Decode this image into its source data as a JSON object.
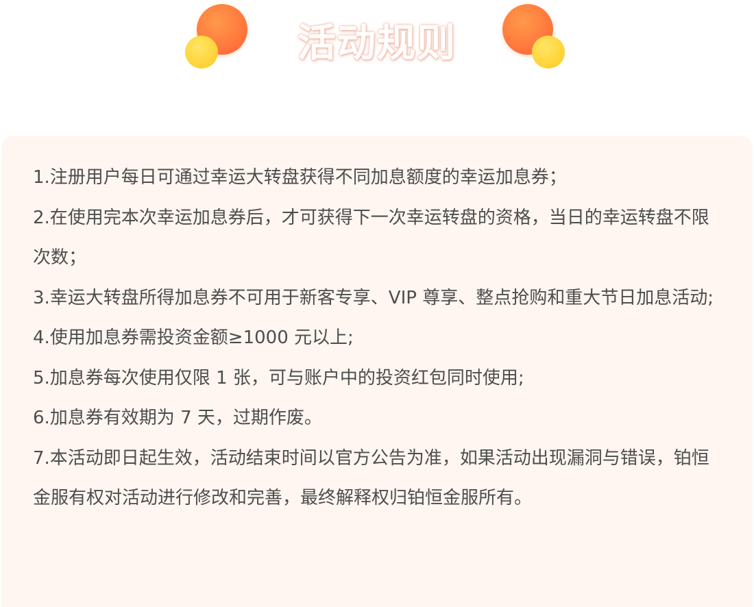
{
  "header": {
    "title": "活动规则"
  },
  "colors": {
    "panel_bg": "#fff6f1",
    "text": "#4d4d4d",
    "deco_orange": "#ff7a3d",
    "deco_yellow": "#ffd233"
  },
  "rules": [
    "1.注册用户每日可通过幸运大转盘获得不同加息额度的幸运加息券；",
    "2.在使用完本次幸运加息券后，才可获得下一次幸运转盘的资格，当日的幸运转盘不限次数；",
    "3.幸运大转盘所得加息券不可用于新客专享、VIP 尊享、整点抢购和重大节日加息活动;",
    "4.使用加息券需投资金额≥1000 元以上;",
    "5.加息券每次使用仅限 1 张，可与账户中的投资红包同时使用;",
    "6.加息券有效期为 7 天，过期作废。",
    "7.本活动即日起生效，活动结束时间以官方公告为准，如果活动出现漏洞与错误，铂恒金服有权对活动进行修改和完善，最终解释权归铂恒金服所有。"
  ]
}
